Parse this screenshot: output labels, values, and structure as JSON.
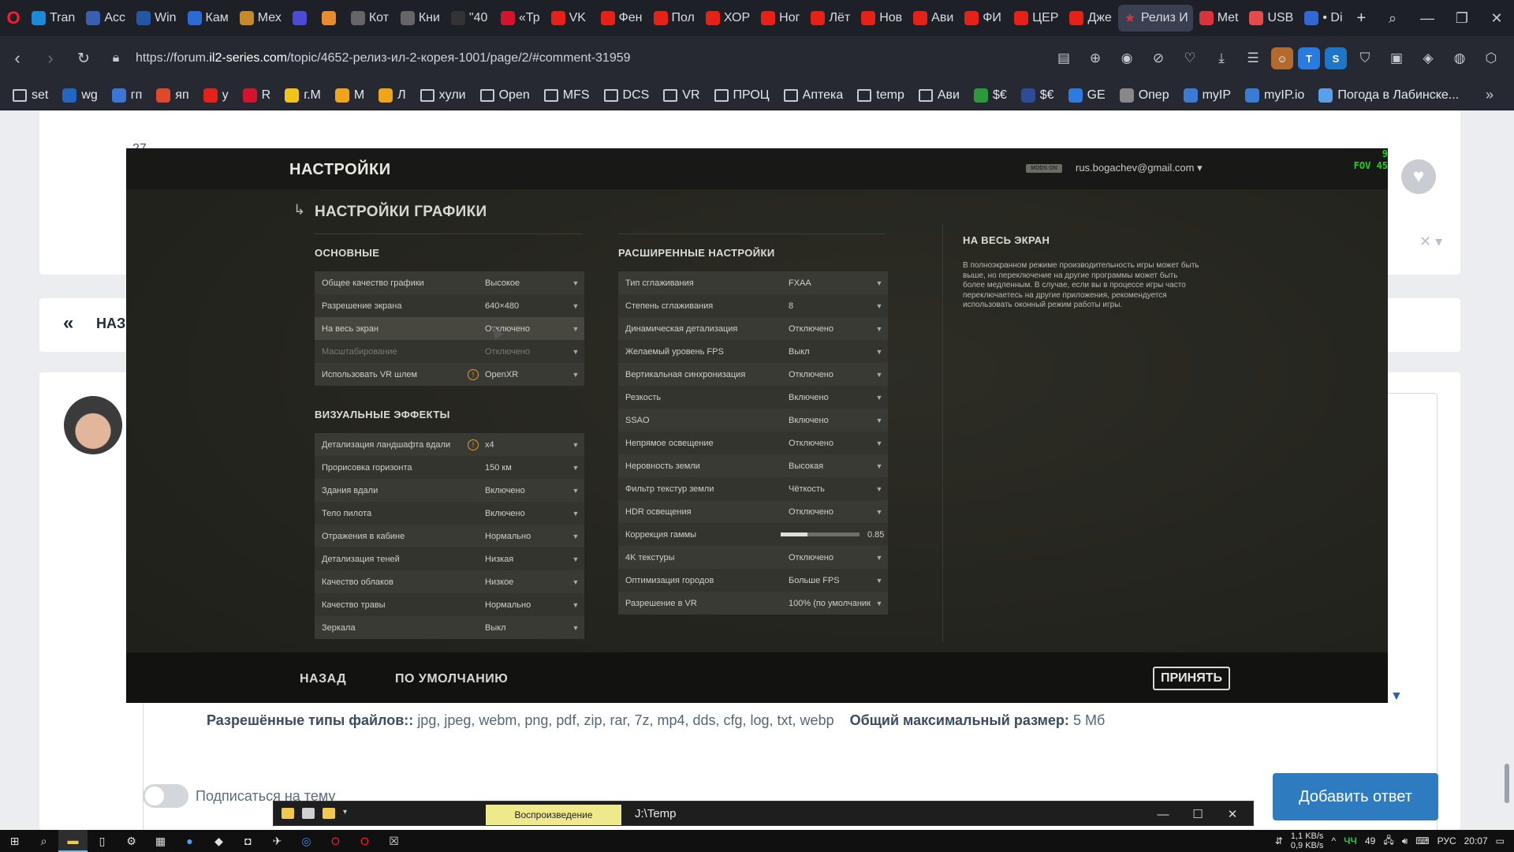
{
  "browser": {
    "tabs": [
      {
        "label": "Tran",
        "color": "#1d8ad9"
      },
      {
        "label": "Acc",
        "color": "#3a5fb0"
      },
      {
        "label": "Win",
        "color": "#2356a5"
      },
      {
        "label": "Кам",
        "color": "#2a6bd6"
      },
      {
        "label": "Мех",
        "color": "#c48a2b"
      },
      {
        "label": "",
        "color": "#4b4bd8"
      },
      {
        "label": "",
        "color": "#e88b2f"
      },
      {
        "label": "Кот",
        "color": "#666"
      },
      {
        "label": "Кни",
        "color": "#666"
      },
      {
        "label": "\"40",
        "color": "#333"
      },
      {
        "label": "«Тр",
        "color": "#d2142d"
      },
      {
        "label": "VK",
        "color": "#e62117"
      },
      {
        "label": "Фен",
        "color": "#e62117"
      },
      {
        "label": "Пол",
        "color": "#e62117"
      },
      {
        "label": "ХОР",
        "color": "#e62117"
      },
      {
        "label": "Ног",
        "color": "#e62117"
      },
      {
        "label": "Лёт",
        "color": "#e62117"
      },
      {
        "label": "Нов",
        "color": "#e62117"
      },
      {
        "label": "Ави",
        "color": "#e62117"
      },
      {
        "label": "ФИ",
        "color": "#e62117"
      },
      {
        "label": "ЦЕР",
        "color": "#e62117"
      },
      {
        "label": "Дже",
        "color": "#e62117"
      },
      {
        "label": "Релиз И",
        "color": "#d9343c",
        "active": true
      },
      {
        "label": "Met",
        "color": "#d9343c"
      },
      {
        "label": "USB",
        "color": "#e64b4b"
      },
      {
        "label": "• Di",
        "color": "#3367d6"
      }
    ],
    "url_prefix": "https://forum.",
    "url_host": "il2-series.com",
    "url_path": "/topic/4652-релиз-ил-2-корея-1001/page/2/#comment-31959",
    "bookmarks": [
      {
        "label": "set",
        "type": "folder"
      },
      {
        "label": "wg",
        "type": "site",
        "color": "#2266c4"
      },
      {
        "label": "гп",
        "type": "site",
        "color": "#3b76d6"
      },
      {
        "label": "яп",
        "type": "site",
        "color": "#e0482a"
      },
      {
        "label": "у",
        "type": "site",
        "color": "#e62117"
      },
      {
        "label": "R",
        "type": "site",
        "color": "#d2142d"
      },
      {
        "label": "г.М",
        "type": "site",
        "color": "#f0c419"
      },
      {
        "label": "М",
        "type": "site",
        "color": "#f0a419"
      },
      {
        "label": "Л",
        "type": "site",
        "color": "#f0a419"
      },
      {
        "label": "хули",
        "type": "folder"
      },
      {
        "label": "Open",
        "type": "folder"
      },
      {
        "label": "MFS",
        "type": "folder"
      },
      {
        "label": "DCS",
        "type": "folder"
      },
      {
        "label": "VR",
        "type": "folder"
      },
      {
        "label": "ПРОЦ",
        "type": "folder"
      },
      {
        "label": "Аптека",
        "type": "folder"
      },
      {
        "label": "temp",
        "type": "folder"
      },
      {
        "label": "Ави",
        "type": "folder"
      },
      {
        "label": "$€",
        "type": "site",
        "color": "#2b9a3b"
      },
      {
        "label": "$€",
        "type": "site",
        "color": "#2e4b9a"
      },
      {
        "label": "GE",
        "type": "site",
        "color": "#2d7be0"
      },
      {
        "label": "Опер",
        "type": "site",
        "color": "#888"
      },
      {
        "label": "myIP",
        "type": "site",
        "color": "#3a7bd5"
      },
      {
        "label": "myIP.io",
        "type": "site",
        "color": "#3a7bd5"
      },
      {
        "label": "Погода в Лабинске...",
        "type": "site",
        "color": "#5aa0e8"
      }
    ]
  },
  "forum": {
    "post_count": "27",
    "back_label": "НАЗ",
    "allowed_files_label": "Разрешённые типы файлов::",
    "allowed_files_value": "jpg, jpeg, webm, png, pdf, zip, rar, 7z, mp4, dds, cfg, log, txt, webp",
    "max_size_label": "Общий максимальный размер:",
    "max_size_value": "5 Мб",
    "subscribe_label": "Подписаться на тему",
    "add_reply_label": "Добавить ответ"
  },
  "game": {
    "title": "НАСТРОЙКИ",
    "badge": "MODS ON",
    "user": "rus.bogachev@gmail.com ▾",
    "fov_line1": "9",
    "fov_line2": "FOV 45",
    "subtitle": "НАСТРОЙКИ ГРАФИКИ",
    "section_basic": "ОСНОВНЫЕ",
    "section_visual": "ВИЗУАЛЬНЫЕ ЭФФЕКТЫ",
    "section_advanced": "РАСШИРЕННЫЕ НАСТРОЙКИ",
    "basic_rows": [
      {
        "label": "Общее качество графики",
        "value": "Высокое"
      },
      {
        "label": "Разрешение экрана",
        "value": "640×480"
      },
      {
        "label": "На весь экран",
        "value": "Отключено",
        "highlight": true
      },
      {
        "label": "Масштабирование",
        "value": "Отключено",
        "dim": true
      },
      {
        "label": "Использовать VR шлем",
        "value": "OpenXR",
        "warn": true
      }
    ],
    "visual_rows": [
      {
        "label": "Детализация ландшафта вдали",
        "value": "x4",
        "warn": true
      },
      {
        "label": "Прорисовка горизонта",
        "value": "150 км"
      },
      {
        "label": "Здания вдали",
        "value": "Включено"
      },
      {
        "label": "Тело пилота",
        "value": "Включено"
      },
      {
        "label": "Отражения в кабине",
        "value": "Нормально"
      },
      {
        "label": "Детализация теней",
        "value": "Низкая"
      },
      {
        "label": "Качество облаков",
        "value": "Низкое"
      },
      {
        "label": "Качество травы",
        "value": "Нормально"
      },
      {
        "label": "Зеркала",
        "value": "Выкл"
      }
    ],
    "advanced_rows": [
      {
        "label": "Тип сглаживания",
        "value": "FXAA"
      },
      {
        "label": "Степень сглаживания",
        "value": "8"
      },
      {
        "label": "Динамическая детализация",
        "value": "Отключено"
      },
      {
        "label": "Желаемый уровень FPS",
        "value": "Выкл"
      },
      {
        "label": "Вертикальная синхронизация",
        "value": "Отключено"
      },
      {
        "label": "Резкость",
        "value": "Включено"
      },
      {
        "label": "SSAO",
        "value": "Включено"
      },
      {
        "label": "Непрямое освещение",
        "value": "Отключено"
      },
      {
        "label": "Неровность земли",
        "value": "Высокая"
      },
      {
        "label": "Фильтр текстур земли",
        "value": "Чёткость"
      },
      {
        "label": "HDR освещения",
        "value": "Отключено"
      },
      {
        "label": "Коррекция гаммы",
        "value": "0.85",
        "slider": true,
        "slider_fraction": 0.34
      },
      {
        "label": "4K текстуры",
        "value": "Отключено"
      },
      {
        "label": "Оптимизация городов",
        "value": "Больше FPS"
      },
      {
        "label": "Разрешение в VR",
        "value": "100% (по умолчанию)"
      }
    ],
    "help_title": "НА ВЕСЬ ЭКРАН",
    "help_text": "В полноэкранном режиме производительность игры может быть выше, но переключение на другие программы может быть более медленным. В случае, если вы в процессе игры часто переключаетесь на другие приложения, рекомендуется использовать оконный режим работы игры.",
    "back_button": "НАЗАД",
    "default_button": "ПО УМОЛЧАНИЮ",
    "accept_button": "ПРИНЯТЬ"
  },
  "explorer": {
    "tab_label": "Воспроизведение",
    "path": "J:\\Temp"
  },
  "taskbar": {
    "net_up": "1,1 KB/s",
    "net_down": "0,9 KB/s",
    "cn_label": "ЧЧ",
    "temp": "49",
    "lang": "РУС",
    "time": "20:07"
  }
}
